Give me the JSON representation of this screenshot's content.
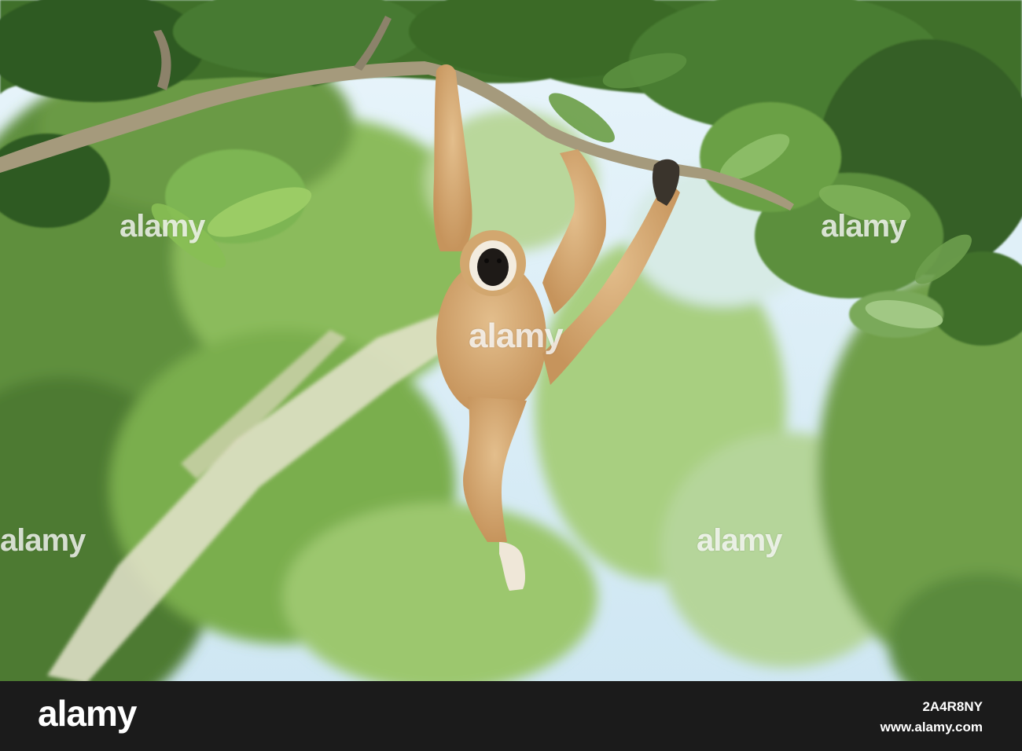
{
  "watermark": {
    "brand": "alamy",
    "image_id": "2A4R8NY",
    "url": "www.alamy.com"
  },
  "colors": {
    "sky": "#dbeef9",
    "foliage_dark": "#2f5a2a",
    "foliage_light": "#8cbc5e",
    "fur": "#d7ad77",
    "bar": "#1b1b1b"
  }
}
